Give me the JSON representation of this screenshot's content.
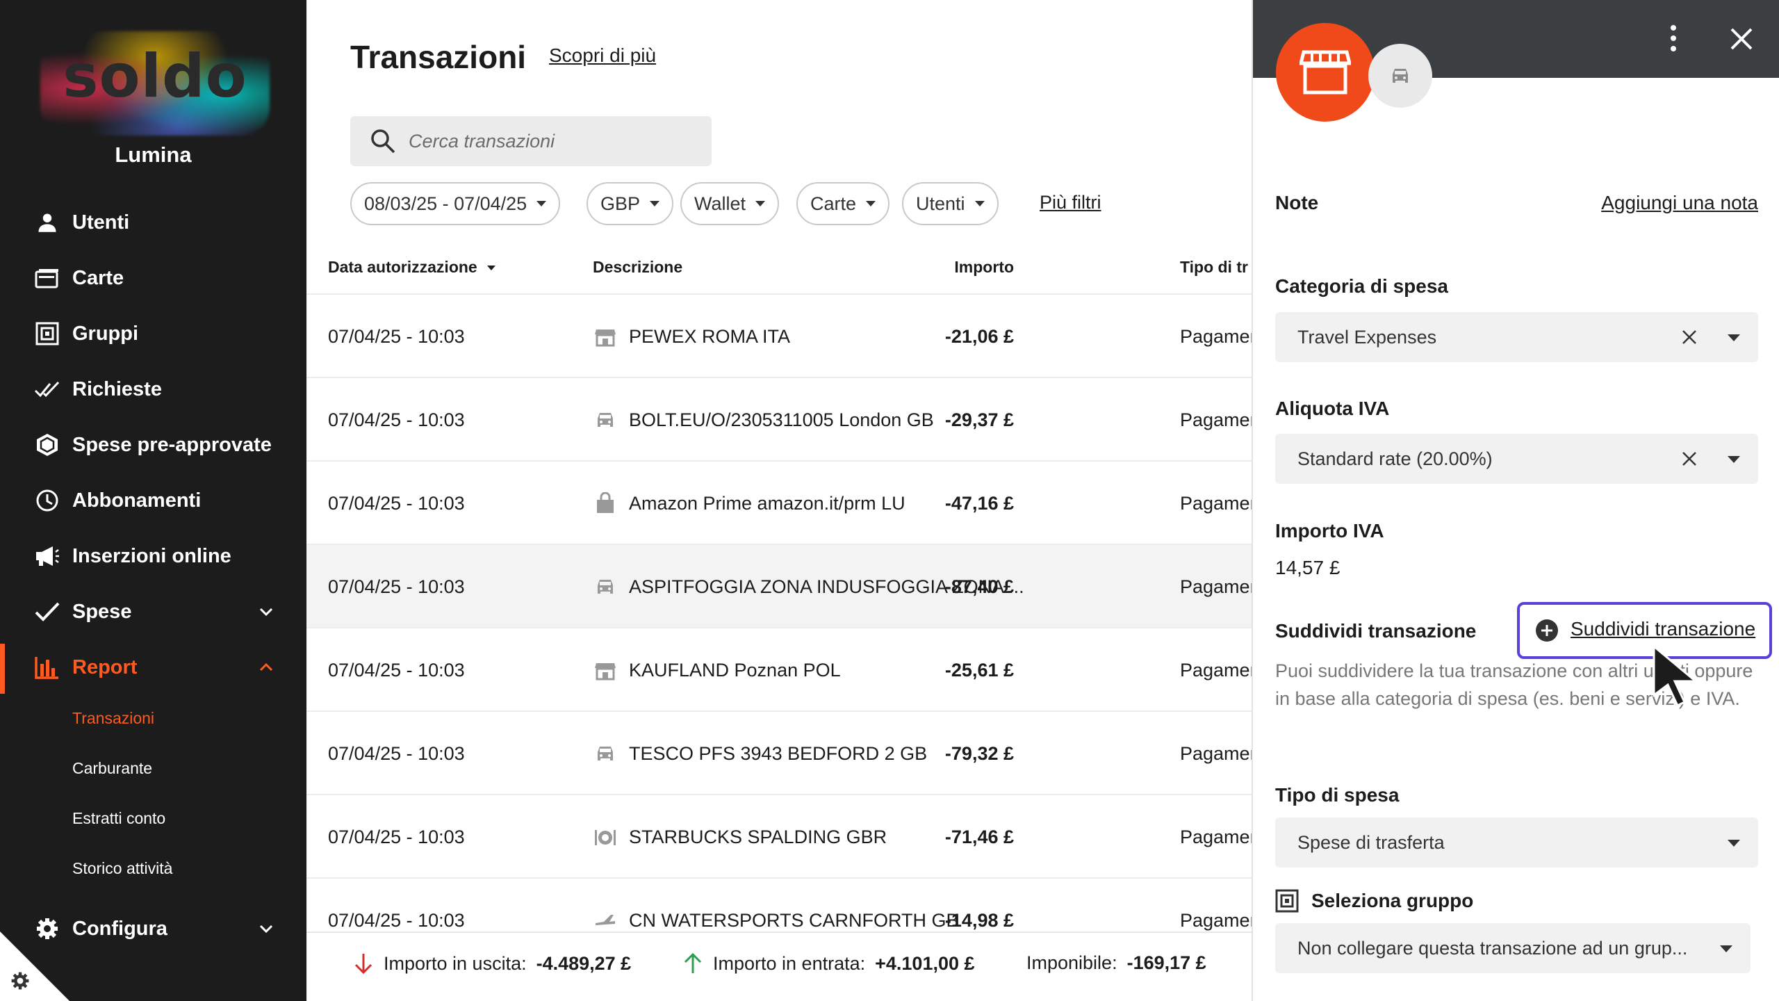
{
  "brand": {
    "logo_text": "soldo",
    "org_name": "Lumina",
    "accent_color": "#ff5a1f"
  },
  "sidebar": {
    "items": [
      {
        "label": "Utenti",
        "icon": "user-icon"
      },
      {
        "label": "Carte",
        "icon": "card-icon"
      },
      {
        "label": "Gruppi",
        "icon": "group-icon"
      },
      {
        "label": "Richieste",
        "icon": "double-check-icon"
      },
      {
        "label": "Spese pre-approvate",
        "icon": "hexagon-icon"
      },
      {
        "label": "Abbonamenti",
        "icon": "clock-icon"
      },
      {
        "label": "Inserzioni online",
        "icon": "megaphone-icon"
      },
      {
        "label": "Spese",
        "icon": "check-icon"
      },
      {
        "label": "Report",
        "icon": "bar-chart-icon"
      },
      {
        "label": "Configura",
        "icon": "gear-icon"
      }
    ],
    "report_sub": [
      "Transazioni",
      "Carburante",
      "Estratti conto",
      "Storico attività"
    ]
  },
  "main": {
    "title": "Transazioni",
    "learn_more": "Scopri di più",
    "search_placeholder": "Cerca transazioni",
    "filters": [
      "08/03/25 - 07/04/25",
      "GBP",
      "Wallet",
      "Carte",
      "Utenti"
    ],
    "more_filters": "Più filtri",
    "columns": [
      "Data autorizzazione",
      "Descrizione",
      "Importo",
      "Tipo di tr"
    ],
    "rows": [
      {
        "date": "07/04/25 - 10:03",
        "icon": "store-icon",
        "description": "PEWEX ROMA ITA",
        "amount": "-21,06 £",
        "type": "Pagamen"
      },
      {
        "date": "07/04/25 - 10:03",
        "icon": "car-icon",
        "description": "BOLT.EU/O/2305311005 London GB",
        "amount": "-29,37 £",
        "type": "Pagamen"
      },
      {
        "date": "07/04/25 - 10:03",
        "icon": "shopping-bag-icon",
        "description": "Amazon Prime amazon.it/prm LU",
        "amount": "-47,16 £",
        "type": "Pagamen"
      },
      {
        "date": "07/04/25 - 10:03",
        "icon": "car-icon",
        "description": "ASPITFOGGIA ZONA INDUSFOGGIA ZONA ...",
        "amount": "-87,40 £",
        "type": "Pagamen"
      },
      {
        "date": "07/04/25 - 10:03",
        "icon": "store-icon",
        "description": "KAUFLAND Poznan POL",
        "amount": "-25,61 £",
        "type": "Pagamen"
      },
      {
        "date": "07/04/25 - 10:03",
        "icon": "car-icon",
        "description": "TESCO PFS 3943 BEDFORD 2 GB",
        "amount": "-79,32 £",
        "type": "Pagamen"
      },
      {
        "date": "07/04/25 - 10:03",
        "icon": "restaurant-icon",
        "description": "STARBUCKS SPALDING GBR",
        "amount": "-71,46 £",
        "type": "Pagamen"
      },
      {
        "date": "07/04/25 - 10:03",
        "icon": "plane-icon",
        "description": "CN WATERSPORTS CARNFORTH GB",
        "amount": "-14,98 £",
        "type": "Pagamen"
      }
    ],
    "footer": {
      "out_label": "Importo in uscita:",
      "out_value": "-4.489,27 £",
      "in_label": "Importo in entrata:",
      "in_value": "+4.101,00 £",
      "taxable_label": "Imponibile:",
      "taxable_value": "-169,17 £"
    }
  },
  "panel": {
    "note_label": "Note",
    "add_note": "Aggiungi una nota",
    "category_label": "Categoria di spesa",
    "category_value": "Travel Expenses",
    "vat_rate_label": "Aliquota IVA",
    "vat_rate_value": "Standard rate (20.00%)",
    "vat_amount_label": "Importo IVA",
    "vat_amount_value": "14,57 £",
    "split_label": "Suddividi transazione",
    "split_button": "Suddividi transazione",
    "split_description": "Puoi suddividere la tua transazione con altri utenti oppure in base alla categoria di spesa (es. beni e servizi) e IVA.",
    "expense_type_label": "Tipo di spesa",
    "expense_type_value": "Spese di trasferta",
    "group_label": "Seleziona gruppo",
    "group_value": "Non collegare questa transazione ad un grup..."
  }
}
